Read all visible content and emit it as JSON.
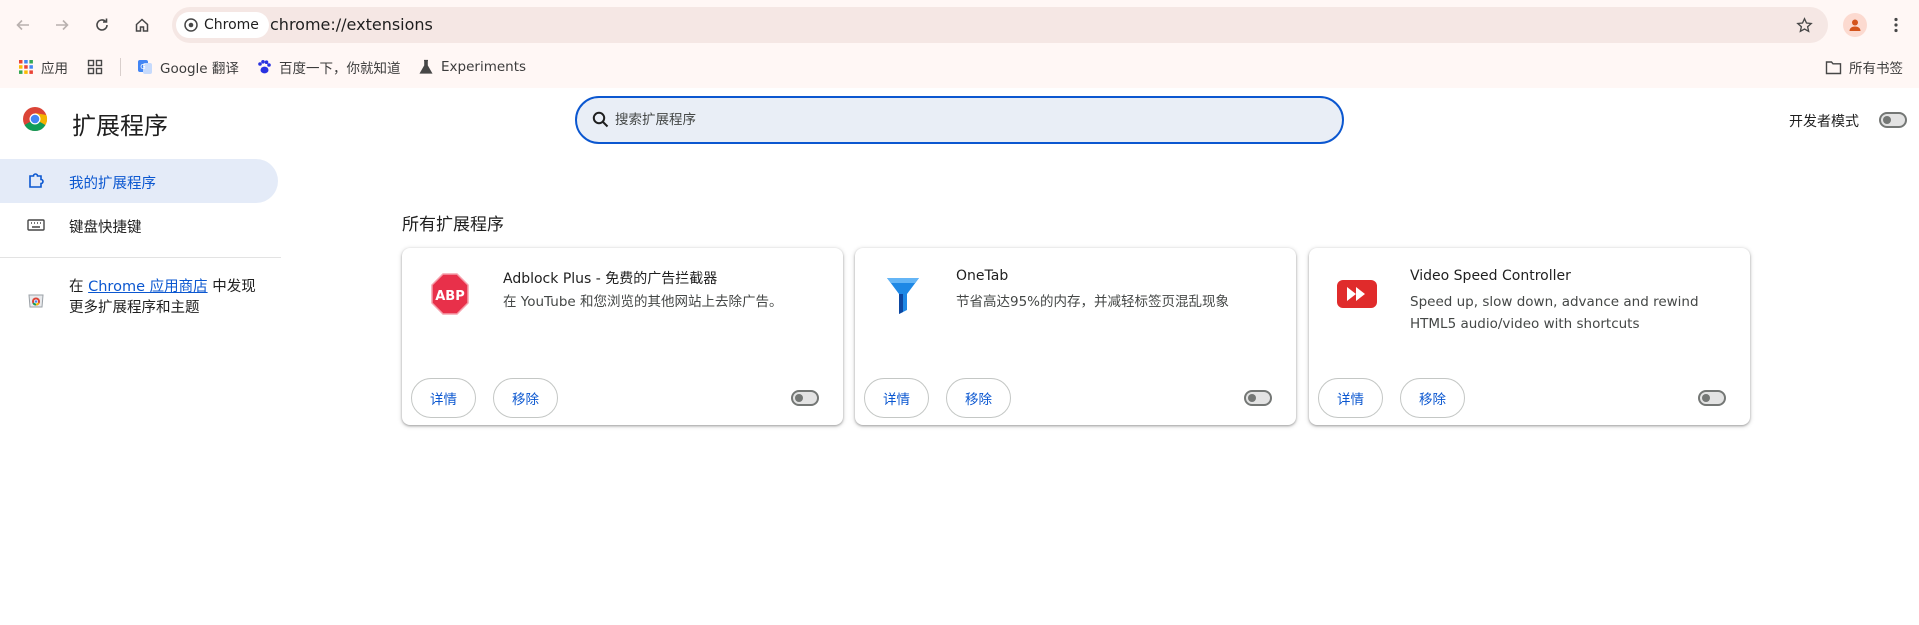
{
  "browser": {
    "chip_label": "Chrome",
    "url": "chrome://extensions"
  },
  "bookmarks": {
    "apps": "应用",
    "items": [
      {
        "label": "Google 翻译"
      },
      {
        "label": "百度一下，你就知道"
      },
      {
        "label": "Experiments"
      }
    ],
    "all_bookmarks": "所有书签"
  },
  "header": {
    "title": "扩展程序",
    "search_placeholder": "搜索扩展程序",
    "dev_mode_label": "开发者模式"
  },
  "sidebar": {
    "items": [
      {
        "label": "我的扩展程序"
      },
      {
        "label": "键盘快捷键"
      }
    ],
    "store_prefix": "在 ",
    "store_link": "Chrome 应用商店",
    "store_suffix": " 中发现更多扩展程序和主题"
  },
  "main": {
    "section_title": "所有扩展程序",
    "extensions": [
      {
        "name": "Adblock Plus - 免费的广告拦截器",
        "description": "在 YouTube 和您浏览的其他网站上去除广告。",
        "details_label": "详情",
        "remove_label": "移除",
        "icon": "abp-icon",
        "enabled": false
      },
      {
        "name": "OneTab",
        "description": "节省高达95%的内存，并减轻标签页混乱现象",
        "details_label": "详情",
        "remove_label": "移除",
        "icon": "onetab-funnel-icon",
        "enabled": false
      },
      {
        "name": "Video Speed Controller",
        "description": "Speed up, slow down, advance and rewind HTML5 audio/video with shortcuts",
        "details_label": "详情",
        "remove_label": "移除",
        "icon": "video-speed-icon",
        "enabled": false
      }
    ]
  },
  "colors": {
    "accent": "#0b57d0",
    "toolbar_bg": "#fff7f5",
    "active_nav_bg": "#e4ebf8",
    "abp_red": "#e8304a",
    "video_red": "#e02b2b"
  }
}
